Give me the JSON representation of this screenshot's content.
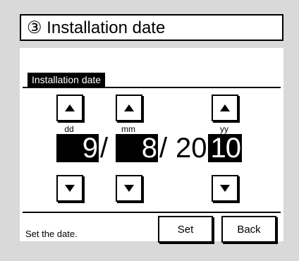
{
  "header": {
    "title": "③ Installation date"
  },
  "section": {
    "label": "Installation date"
  },
  "date": {
    "dd_label": "dd",
    "mm_label": "mm",
    "yy_label": "yy",
    "day": "9",
    "month": "8",
    "year_prefix": "20",
    "year": "10",
    "separator1": "/",
    "separator2": "/"
  },
  "footer": {
    "hint": "Set the date.",
    "set_label": "Set",
    "back_label": "Back"
  },
  "icons": {
    "up": "triangle-up-icon",
    "down": "triangle-down-icon"
  }
}
